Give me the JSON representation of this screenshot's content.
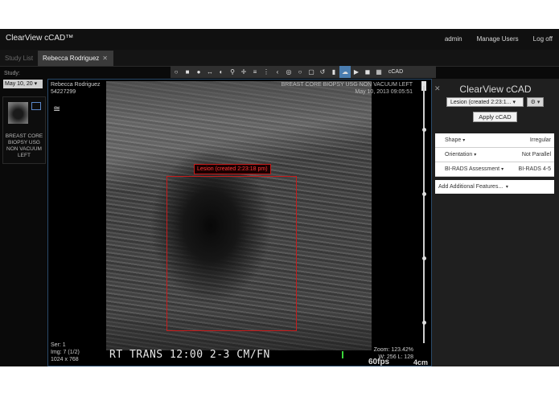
{
  "app": {
    "title": "ClearView cCAD™"
  },
  "topnav": {
    "user": "admin",
    "manage_users": "Manage Users",
    "logoff": "Log off"
  },
  "tabs": [
    {
      "label": "Study List"
    },
    {
      "label": "Rebecca Rodriguez"
    }
  ],
  "toolbar": {
    "tools": [
      "circle-icon",
      "square-icon",
      "dot-icon",
      "resize-icon",
      "contrast-icon",
      "zoom-icon",
      "pan-icon",
      "menu-icon",
      "more-icon",
      "chevron-left-icon",
      "target-icon",
      "ring-icon",
      "rect-icon",
      "undo-icon",
      "trash-icon",
      "cad-icon",
      "play-icon",
      "record-icon",
      "layout-icon"
    ],
    "cad_label": "cCAD",
    "active_tool": "cad-icon"
  },
  "left": {
    "study_label": "Study:",
    "study_select": "May 10, 20",
    "thumb_label": "BREAST CORE BIOPSY USG NON VACUUM LEFT"
  },
  "viewer": {
    "patient_name": "Rebecca Rodriguez",
    "patient_id": "54227299",
    "study_desc": "BREAST CORE BIOPSY USG NON VACUUM LEFT",
    "study_date": "May 10, 2013 09:05:51",
    "lesion_label": "Lesion (created 2:23:18 pm)",
    "series": "Ser: 1",
    "image": "Img: 7 (1/2)",
    "dims": "1024 x 768",
    "zoom": "Zoom: 123.42%",
    "wl": "W: 256 L: 128",
    "caption": "RT TRANS 12:00 2-3 CM/FN",
    "fps": "60fps",
    "scale": "4cm"
  },
  "cad": {
    "title": "ClearView cCAD",
    "lesion_select": "Lesion (created 2:23:1...",
    "apply_label": "Apply cCAD",
    "features": [
      {
        "name": "Shape",
        "value": "Irregular"
      },
      {
        "name": "Orientation",
        "value": "Not Parallel"
      },
      {
        "name": "BI-RADS Assessment",
        "value": "BI-RADS 4-5"
      }
    ],
    "add_features": "Add Additional Features..."
  },
  "colors": {
    "accent": "#4a7db0",
    "lesion": "#c61b1b",
    "background": "#0a0a0a"
  }
}
